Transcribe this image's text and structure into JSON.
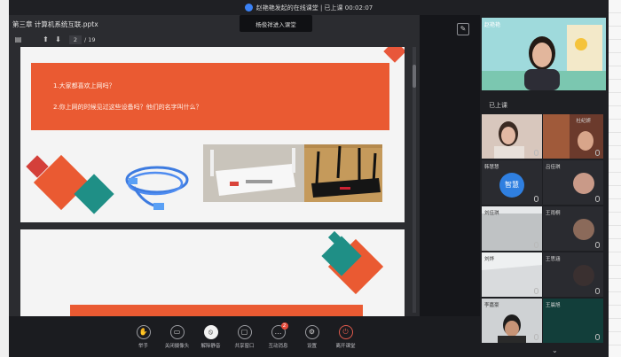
{
  "window": {
    "title": "赵艳艳发起的在线课堂 | 已上课 00:02:07"
  },
  "toast": {
    "text": "杨俊祥进入课堂"
  },
  "viewer": {
    "file_title": "第三章 计算机系统互联.pptx",
    "page_current": "2",
    "page_total": "/ 19"
  },
  "slide": {
    "q1": "1.大家都喜欢上网吗？",
    "q2": "2.你上网的时候见过这些设备吗？他们的名字叫什么？"
  },
  "colors": {
    "accent_orange": "#ea5a32",
    "teal": "#1f8f86",
    "red": "#d4403a"
  },
  "dock": {
    "items": [
      {
        "label": "举手",
        "icon": "hand-icon"
      },
      {
        "label": "关闭摄像头",
        "icon": "camera-icon"
      },
      {
        "label": "解除静音",
        "icon": "mic-muted-icon",
        "active": true
      },
      {
        "label": "共享窗口",
        "icon": "screen-share-icon"
      },
      {
        "label": "互动消息",
        "icon": "chat-icon",
        "badge": "2"
      },
      {
        "label": "设置",
        "icon": "gear-icon"
      },
      {
        "label": "离开课堂",
        "icon": "power-icon"
      }
    ]
  },
  "sidebar": {
    "teacher_name": "赵艳艳",
    "section_label": "已上课",
    "tiles": [
      {
        "name": ""
      },
      {
        "name": "杜纪妍"
      },
      {
        "name": "韩慧慧"
      },
      {
        "name": "吕佳琪",
        "avatar_text": "智慧"
      },
      {
        "name": "刘佳琪"
      },
      {
        "name": "王雨桐"
      },
      {
        "name": "刘烨"
      },
      {
        "name": "王思涵"
      },
      {
        "name": "李嘉豪"
      },
      {
        "name": "王晨旭"
      }
    ]
  }
}
